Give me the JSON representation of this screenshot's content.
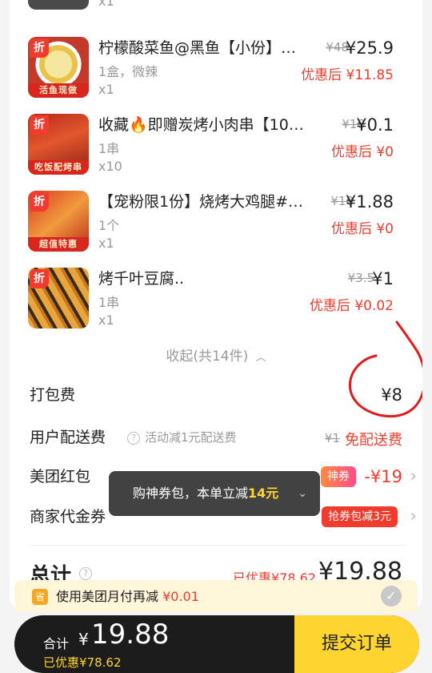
{
  "items": [
    {
      "name": "",
      "spec": "",
      "qty": "x1",
      "badge": "",
      "band": ""
    },
    {
      "name": "柠檬酸菜鱼@黑鱼【小份】…",
      "spec": "1盒，微辣",
      "qty": "x1",
      "orig": "¥48",
      "price": "¥25.9",
      "after": "优惠后 ¥11.85",
      "badge": "折",
      "band": "活鱼现做"
    },
    {
      "name": "收藏🔥即赠炭烤小肉串【10…",
      "spec": "1串",
      "qty": "x10",
      "orig": "¥18",
      "price": "¥0.1",
      "after": "优惠后 ¥0",
      "badge": "折",
      "band": "吃饭配烤串"
    },
    {
      "name": "【宠粉限1份】烧烤大鸡腿#…",
      "spec": "1个",
      "qty": "x1",
      "orig": "¥18",
      "price": "¥1.88",
      "after": "优惠后 ¥0",
      "badge": "折",
      "band": "超值特惠"
    },
    {
      "name": "烤千叶豆腐..",
      "spec": "1串",
      "qty": "x1",
      "orig": "¥3.5",
      "price": "¥1",
      "after": "优惠后 ¥0.02",
      "badge": "折",
      "band": ""
    }
  ],
  "collapse": {
    "label": "收起(共14件)",
    "icon": "chevron-up-icon"
  },
  "fees": {
    "packing": {
      "label": "打包费",
      "value": "¥8"
    },
    "delivery": {
      "label": "用户配送费",
      "hint": "活动减1元配送费",
      "orig": "¥1",
      "value": "免配送费"
    },
    "redpacket": {
      "label": "美团红包",
      "tag": "神券",
      "value": "-¥19"
    },
    "voucher": {
      "label": "商家代金券",
      "tag": "抢券包减3元"
    }
  },
  "toast": {
    "text": "购神券包，本单立减",
    "amount": "14元"
  },
  "total": {
    "label": "总计",
    "discount": "已优惠¥78.62",
    "value": "¥19.88"
  },
  "monthly_pay": {
    "icon": "省",
    "text": "使用美团月付再减",
    "amount": "¥0.01"
  },
  "bottom_bar": {
    "label": "合计",
    "currency": "¥",
    "amount": "19.88",
    "saved": "已优惠¥78.62",
    "submit": "提交订单"
  },
  "colors": {
    "accent_red": "#f03c2c",
    "brand_yellow": "#ffd42e"
  }
}
